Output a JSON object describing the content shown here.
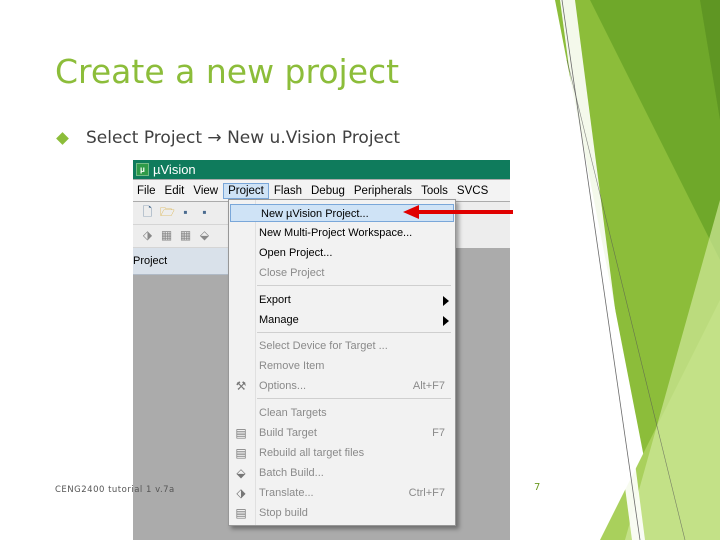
{
  "slide": {
    "title": "Create a new project",
    "bullet": "Select Project → New u.Vision Project",
    "footer": "CENG2400 tutorial 1 v.7a",
    "page_number": "7",
    "accent_color": "#8cbd3a"
  },
  "app": {
    "window_title": "µVision",
    "menubar": [
      "File",
      "Edit",
      "View",
      "Project",
      "Flash",
      "Debug",
      "Peripherals",
      "Tools",
      "SVCS"
    ],
    "active_menu": "Project",
    "project_panel_label": "Project"
  },
  "dropdown": {
    "items": [
      {
        "label": "New µVision Project...",
        "shortcut": "",
        "disabled": false,
        "selected": true,
        "icon": ""
      },
      {
        "label": "New Multi-Project Workspace...",
        "shortcut": "",
        "disabled": false,
        "icon": ""
      },
      {
        "label": "Open Project...",
        "shortcut": "",
        "disabled": false,
        "icon": ""
      },
      {
        "label": "Close Project",
        "shortcut": "",
        "disabled": true,
        "icon": ""
      },
      {
        "label": "Export",
        "shortcut": "",
        "disabled": false,
        "submenu": true,
        "icon": ""
      },
      {
        "label": "Manage",
        "shortcut": "",
        "disabled": false,
        "submenu": true,
        "icon": ""
      },
      {
        "label": "Select Device for Target ...",
        "shortcut": "",
        "disabled": true,
        "icon": ""
      },
      {
        "label": "Remove Item",
        "shortcut": "",
        "disabled": true,
        "icon": ""
      },
      {
        "label": "Options...",
        "shortcut": "Alt+F7",
        "disabled": true,
        "icon": "options-icon"
      },
      {
        "label": "Clean Targets",
        "shortcut": "",
        "disabled": true,
        "icon": ""
      },
      {
        "label": "Build Target",
        "shortcut": "F7",
        "disabled": true,
        "icon": "build-icon"
      },
      {
        "label": "Rebuild all target files",
        "shortcut": "",
        "disabled": true,
        "icon": "rebuild-icon"
      },
      {
        "label": "Batch Build...",
        "shortcut": "",
        "disabled": true,
        "icon": "batch-build-icon"
      },
      {
        "label": "Translate...",
        "shortcut": "Ctrl+F7",
        "disabled": true,
        "icon": "translate-icon"
      },
      {
        "label": "Stop build",
        "shortcut": "",
        "disabled": true,
        "icon": "stop-build-icon"
      }
    ]
  }
}
